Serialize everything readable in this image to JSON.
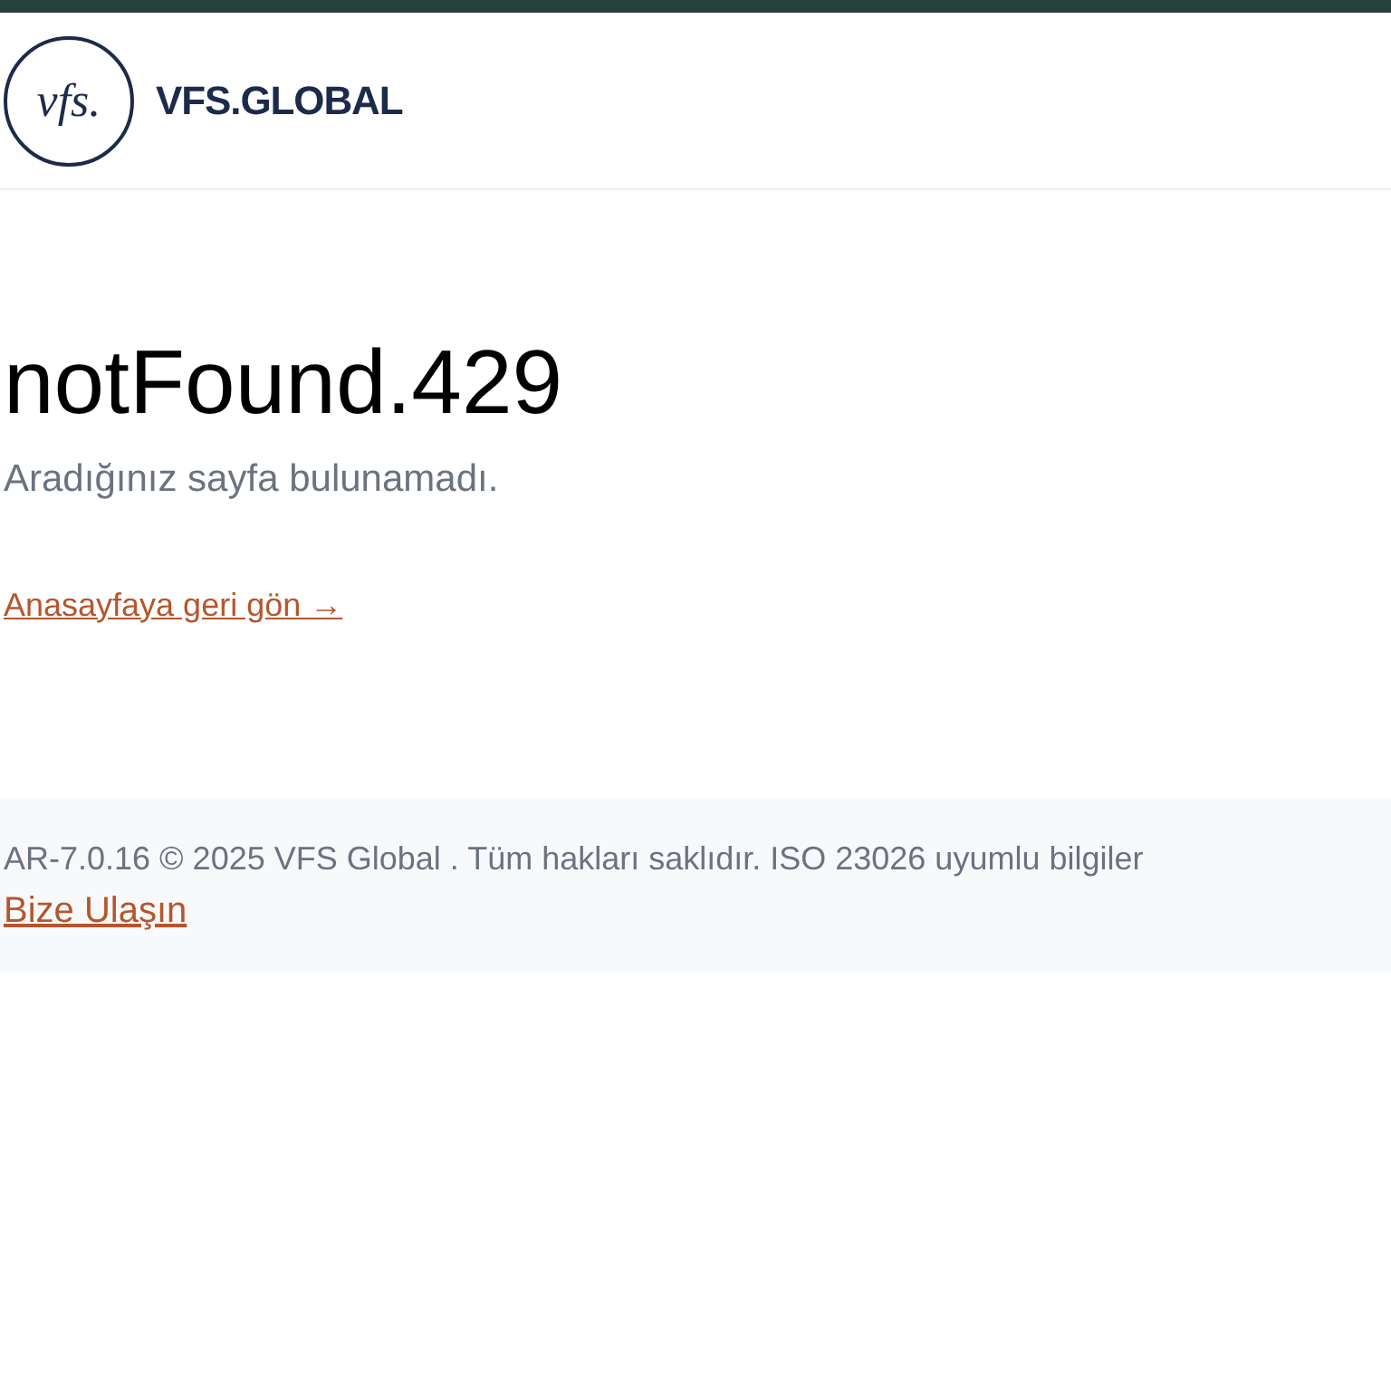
{
  "header": {
    "logo_mark": "vfs.",
    "logo_text": "VFS.GLOBAL"
  },
  "main": {
    "title": "notFound.429",
    "message": "Aradığınız sayfa bulunamadı.",
    "home_link": "Anasayfaya geri gön →"
  },
  "footer": {
    "copyright": "AR-7.0.16 © 2025 VFS Global . Tüm hakları saklıdır. ISO 23026 uyumlu bilgiler",
    "contact_link": "Bize Ulaşın"
  }
}
